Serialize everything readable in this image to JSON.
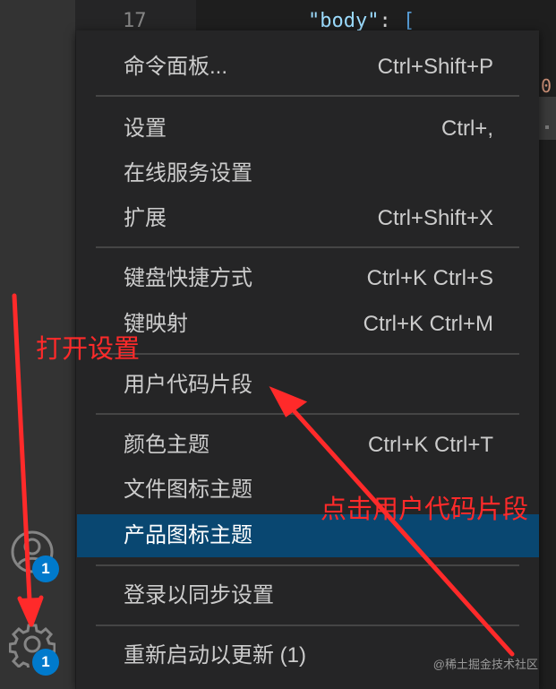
{
  "editor": {
    "line_number": "17",
    "code_key": "\"body\"",
    "code_colon": ":",
    "code_bracket": "[",
    "minimap_fragment": "0"
  },
  "activity_bar": {
    "account_badge": "1",
    "settings_badge": "1",
    "account_icon": "account-icon",
    "settings_icon": "gear-icon"
  },
  "menu": {
    "items": [
      {
        "label": "命令面板...",
        "shortcut": "Ctrl+Shift+P"
      },
      {
        "label": "设置",
        "shortcut": "Ctrl+,"
      },
      {
        "label": "在线服务设置",
        "shortcut": ""
      },
      {
        "label": "扩展",
        "shortcut": "Ctrl+Shift+X"
      },
      {
        "label": "键盘快捷方式",
        "shortcut": "Ctrl+K Ctrl+S"
      },
      {
        "label": "键映射",
        "shortcut": "Ctrl+K Ctrl+M"
      },
      {
        "label": "用户代码片段",
        "shortcut": ""
      },
      {
        "label": "颜色主题",
        "shortcut": "Ctrl+K Ctrl+T"
      },
      {
        "label": "文件图标主题",
        "shortcut": ""
      },
      {
        "label": "产品图标主题",
        "shortcut": ""
      },
      {
        "label": "登录以同步设置",
        "shortcut": ""
      },
      {
        "label": "重新启动以更新 (1)",
        "shortcut": ""
      }
    ],
    "selected_index": 9
  },
  "annotations": {
    "open_settings": "打开设置",
    "click_snippets": "点击用户代码片段",
    "color": "#ff2a2a"
  },
  "watermark": "@稀土掘金技术社区",
  "colors": {
    "menu_bg": "#252526",
    "selection_bg": "#094771",
    "badge": "#007acc",
    "activity_bg": "#333333"
  }
}
